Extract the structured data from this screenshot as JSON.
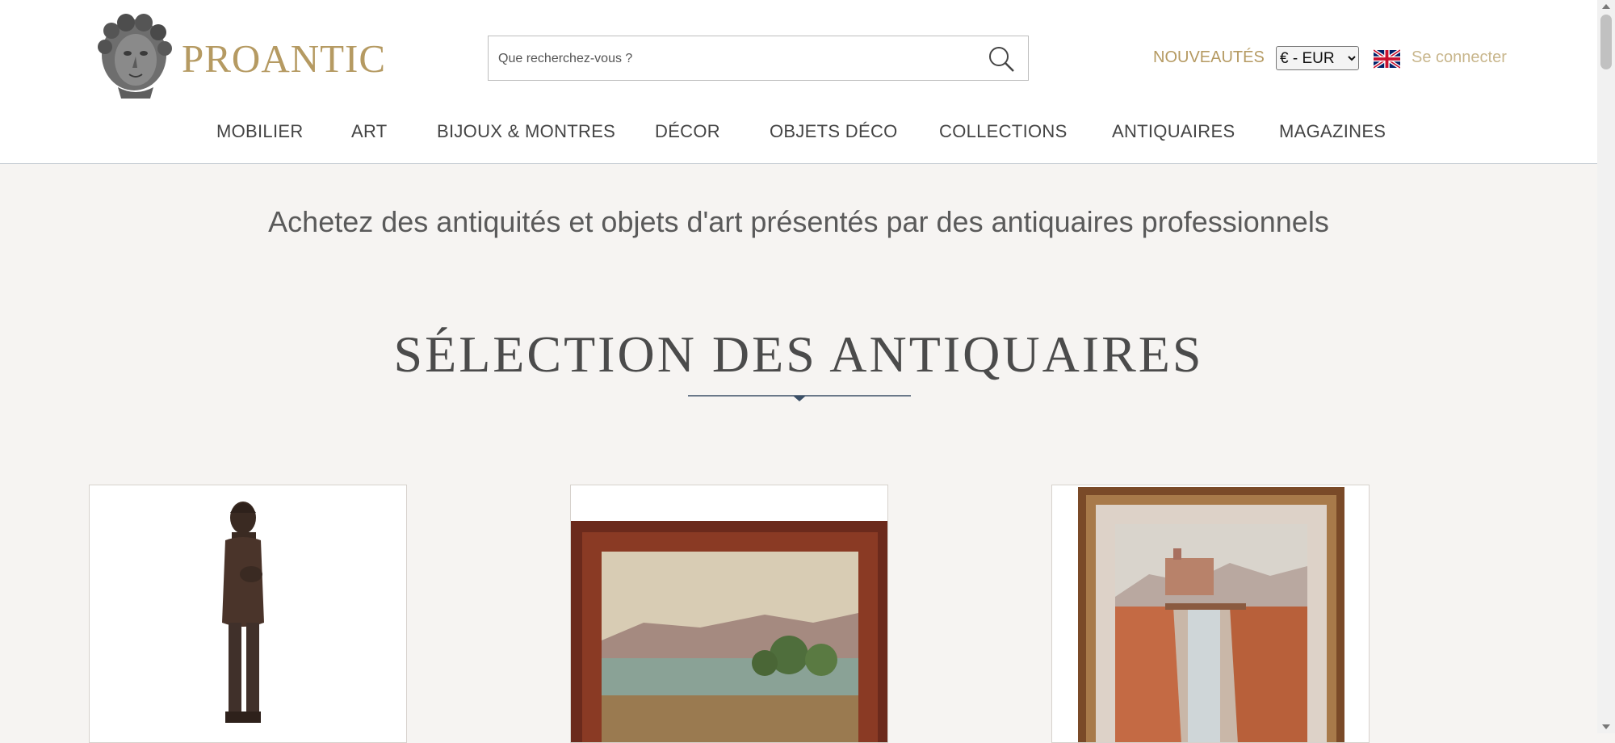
{
  "header": {
    "brand": "PROANTIC",
    "search_placeholder": "Que recherchez-vous ?",
    "new_label": "NOUVEAUTÉS",
    "currency_selected": "€ - EUR",
    "login_label": "Se connecter"
  },
  "nav": {
    "items": [
      "MOBILIER",
      "ART",
      "BIJOUX & MONTRES",
      "DÉCOR",
      "OBJETS DÉCO",
      "COLLECTIONS",
      "ANTIQUAIRES",
      "MAGAZINES"
    ]
  },
  "main": {
    "tagline": "Achetez des antiquités et objets d'art présentés par des antiquaires professionnels",
    "section_title": "SÉLECTION DES ANTIQUAIRES"
  },
  "colors": {
    "brand_gold": "#b59a62",
    "background": "#f6f4f2"
  },
  "icons": [
    "sculpted-head-logo-icon",
    "search-icon",
    "uk-flag-icon"
  ]
}
